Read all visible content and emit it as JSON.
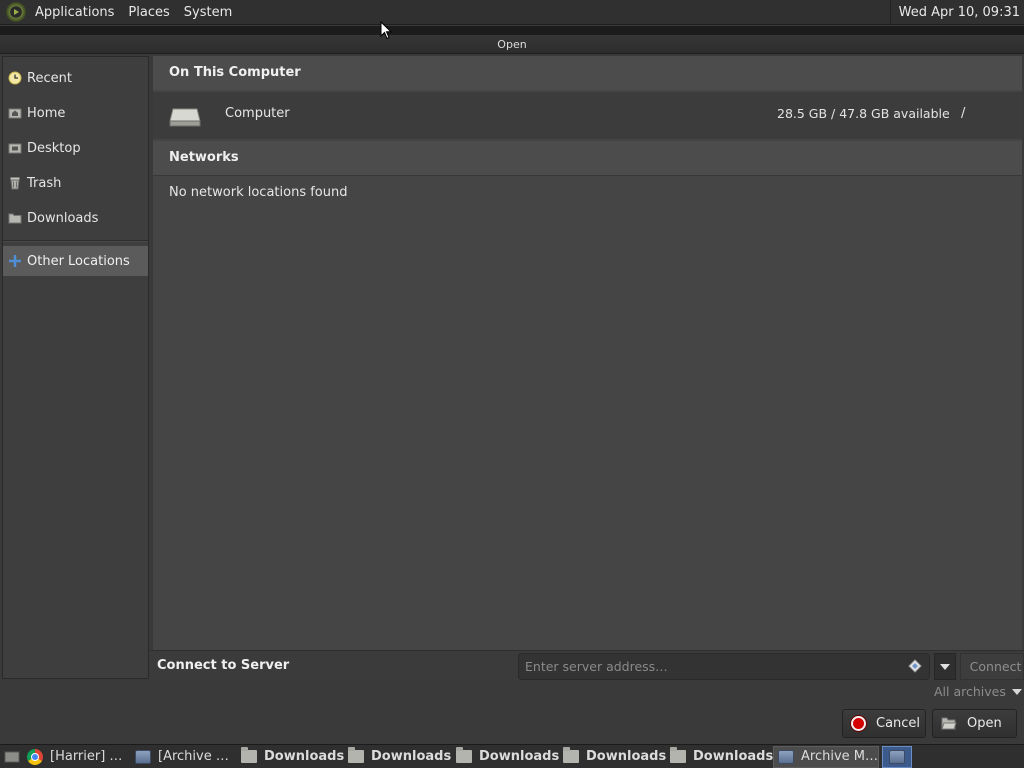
{
  "top_panel": {
    "menus": [
      "Applications",
      "Places",
      "System"
    ],
    "clock": "Wed Apr 10, 09:31"
  },
  "dialog": {
    "title": "Open"
  },
  "sidebar": {
    "items": [
      {
        "label": "Recent",
        "icon": "clock-icon"
      },
      {
        "label": "Home",
        "icon": "home-icon"
      },
      {
        "label": "Desktop",
        "icon": "desktop-icon"
      },
      {
        "label": "Trash",
        "icon": "trash-icon"
      },
      {
        "label": "Downloads",
        "icon": "folder-icon"
      },
      {
        "label": "Other Locations",
        "icon": "plus-icon",
        "selected": true
      }
    ]
  },
  "main": {
    "on_this_computer": {
      "heading": "On This Computer",
      "computer": {
        "name": "Computer",
        "space": "28.5 GB / 47.8 GB available",
        "mount": "/"
      }
    },
    "networks": {
      "heading": "Networks",
      "empty_text": "No network locations found"
    }
  },
  "connect": {
    "label": "Connect to Server",
    "placeholder": "Enter server address…",
    "button": "Connect"
  },
  "filter": {
    "value": "All archives"
  },
  "buttons": {
    "cancel": "Cancel",
    "open": "Open"
  },
  "taskbar": {
    "tasks": [
      {
        "label": "[Harrier] …",
        "icon": "chrome-icon"
      },
      {
        "label": "[Archive …",
        "icon": "archive-manager-icon"
      },
      {
        "label": "Downloads",
        "icon": "folder-icon"
      },
      {
        "label": "Downloads",
        "icon": "folder-icon"
      },
      {
        "label": "Downloads",
        "icon": "folder-icon"
      },
      {
        "label": "Downloads",
        "icon": "folder-icon"
      },
      {
        "label": "Downloads",
        "icon": "folder-icon"
      },
      {
        "label": "Archive M…",
        "icon": "archive-manager-icon",
        "active": true
      }
    ]
  },
  "colors": {
    "selection": "#5b5b5b",
    "cancel_icon": "#d40000",
    "panel": "#303030"
  }
}
